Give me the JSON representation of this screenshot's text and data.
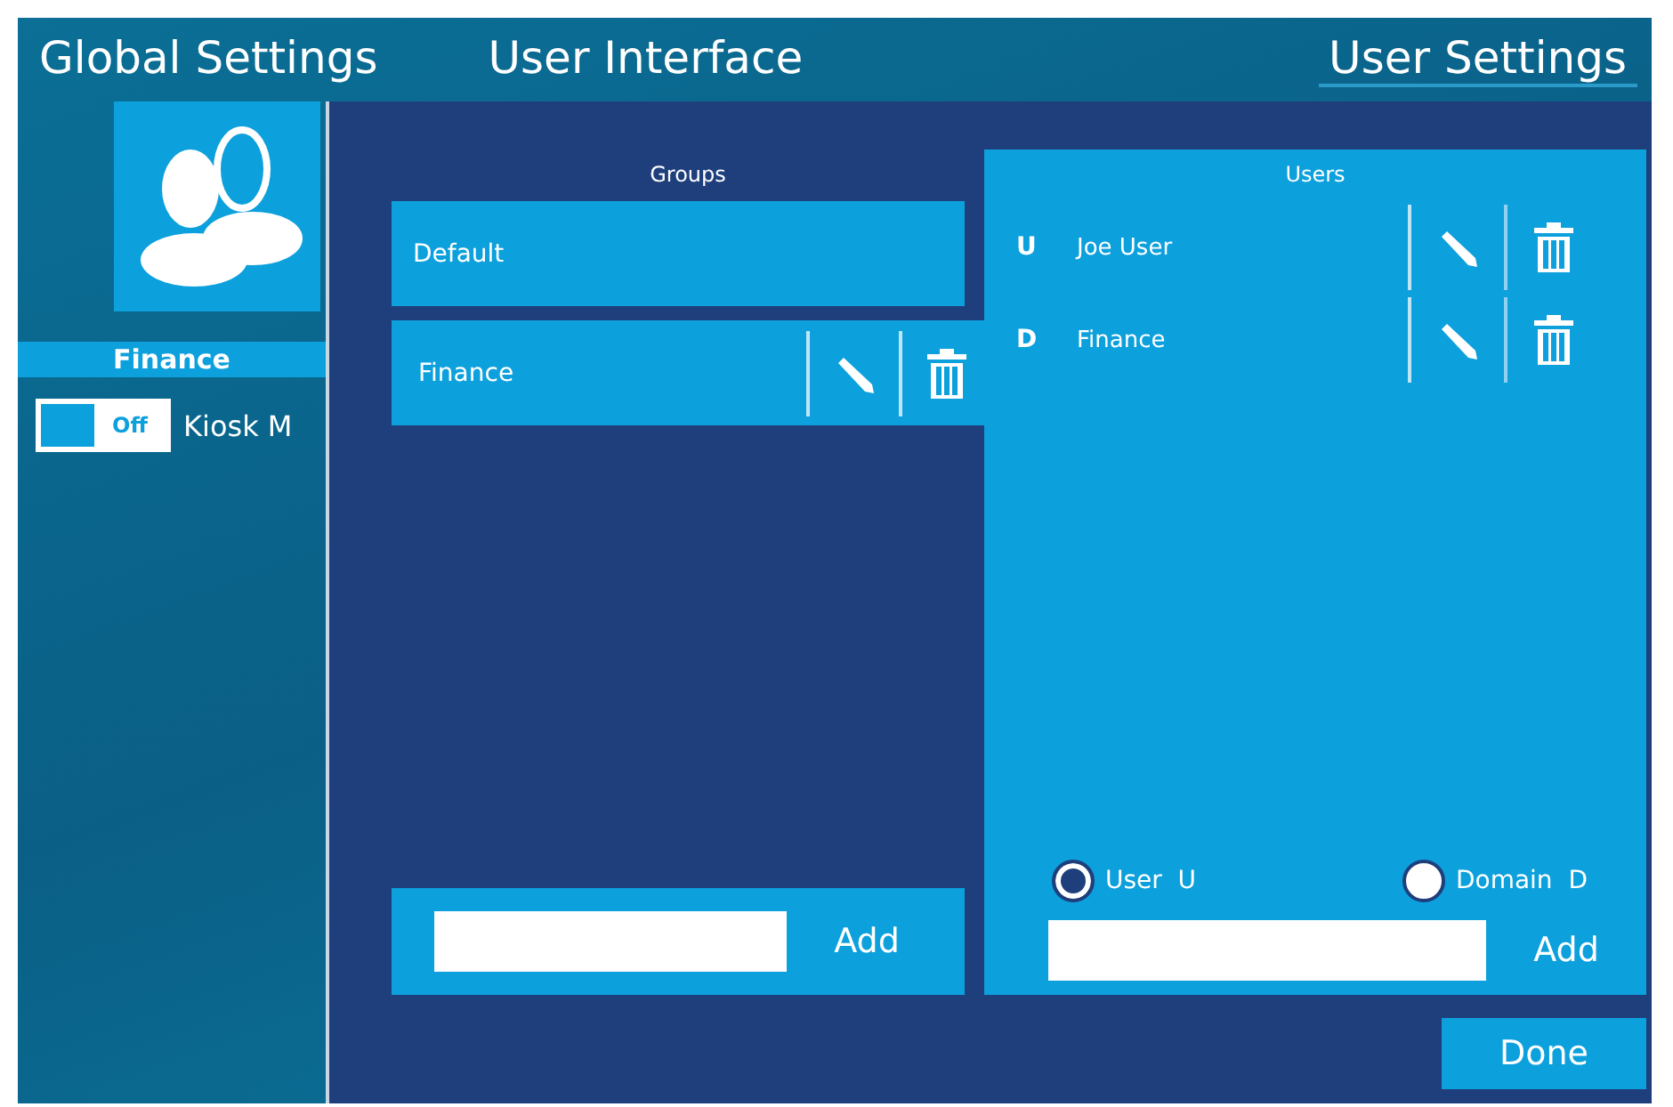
{
  "tabs": [
    {
      "label": "Global Settings",
      "selected": false
    },
    {
      "label": "User Interface",
      "selected": false
    },
    {
      "label": "User Settings",
      "selected": true
    }
  ],
  "sidebar": {
    "group_name": "Finance",
    "kiosk_toggle": {
      "label": "Off",
      "on": false
    },
    "kiosk_label": "Kiosk M"
  },
  "dialog": {
    "groups": {
      "title": "Groups",
      "items": [
        {
          "name": "Default",
          "selected": false
        },
        {
          "name": "Finance",
          "selected": true
        }
      ],
      "add_button": "Add"
    },
    "users": {
      "title": "Users",
      "items": [
        {
          "type": "U",
          "name": "Joe User"
        },
        {
          "type": "D",
          "name": "Finance"
        }
      ],
      "options": [
        {
          "label": "User  U",
          "selected": true
        },
        {
          "label": "Domain  D",
          "selected": false
        }
      ],
      "add_button": "Add"
    },
    "done_button": "Done"
  }
}
